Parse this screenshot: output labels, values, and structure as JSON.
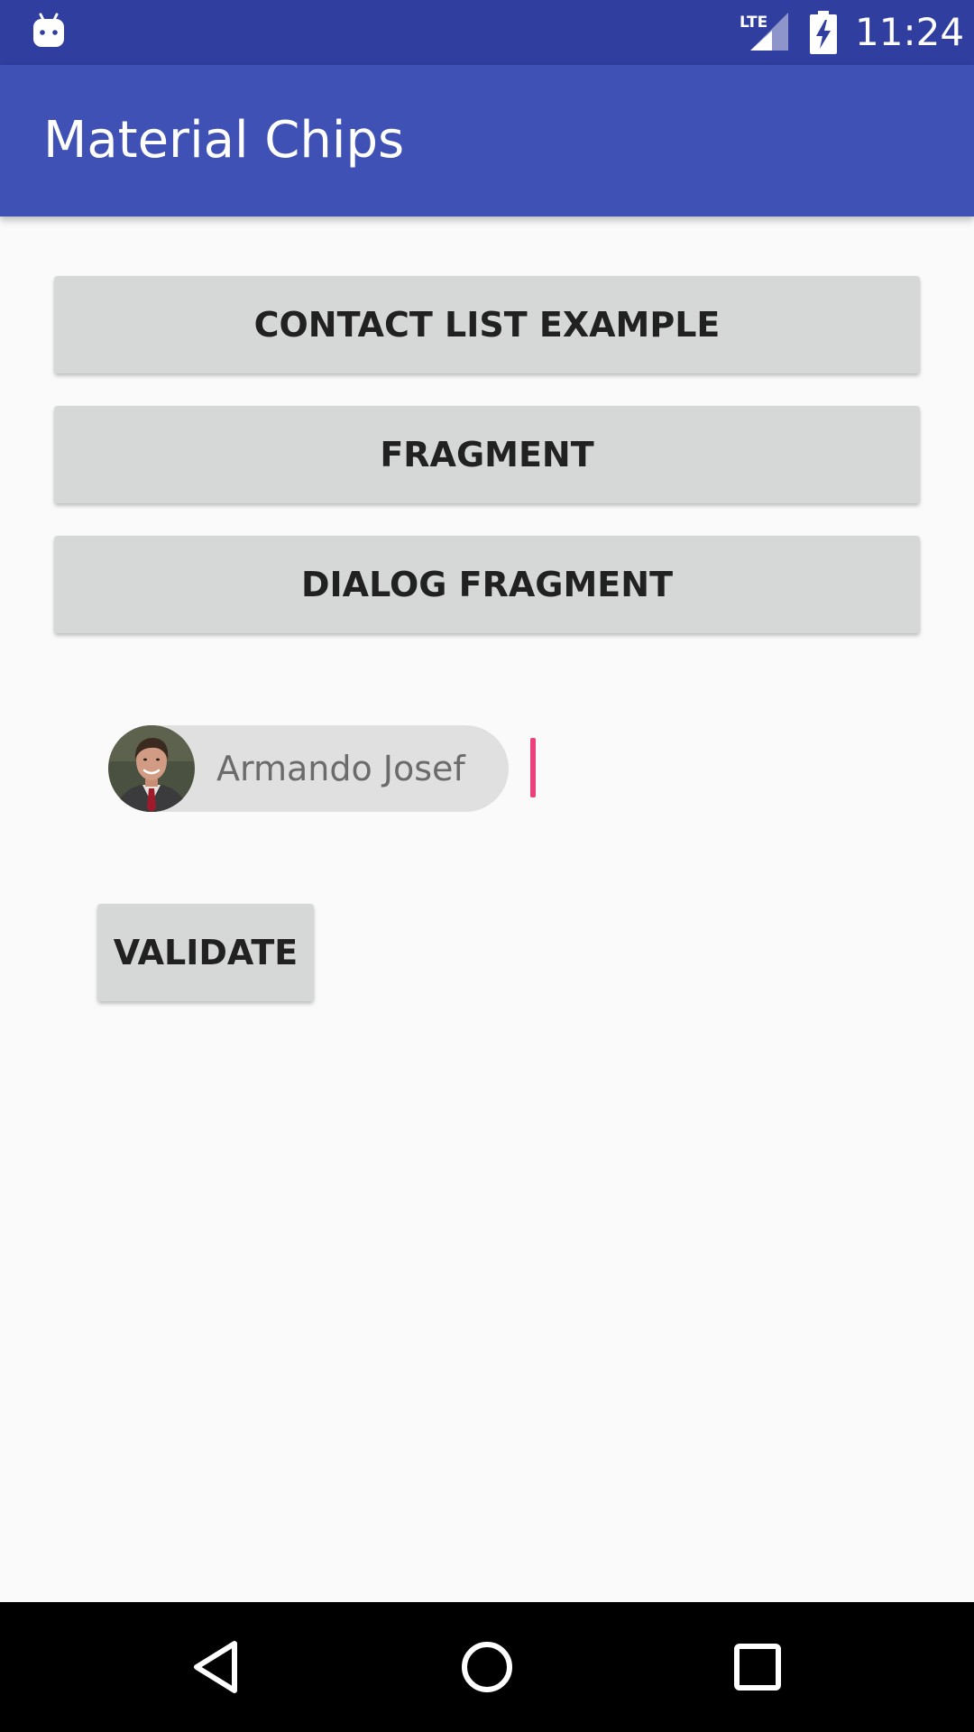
{
  "status_bar": {
    "time": "11:24",
    "network_label": "LTE",
    "icons": [
      "android-notification-icon",
      "lte-signal-icon",
      "battery-charging-icon"
    ]
  },
  "app_bar": {
    "title": "Material Chips"
  },
  "buttons": {
    "contact_list": "CONTACT LIST EXAMPLE",
    "fragment": "FRAGMENT",
    "dialog_fragment": "DIALOG FRAGMENT",
    "validate": "VALIDATE"
  },
  "chips_input": {
    "chips": [
      {
        "label": "Armando Josef",
        "icon": "contact-avatar"
      }
    ],
    "value": ""
  },
  "nav_bar": {
    "icons": [
      "back-icon",
      "home-icon",
      "recent-apps-icon"
    ]
  },
  "colors": {
    "status_bar": "#303f9f",
    "app_bar": "#3f51b5",
    "button_bg": "#d6d7d7",
    "chip_bg": "#e0e0e0",
    "cursor": "#ec407a"
  }
}
